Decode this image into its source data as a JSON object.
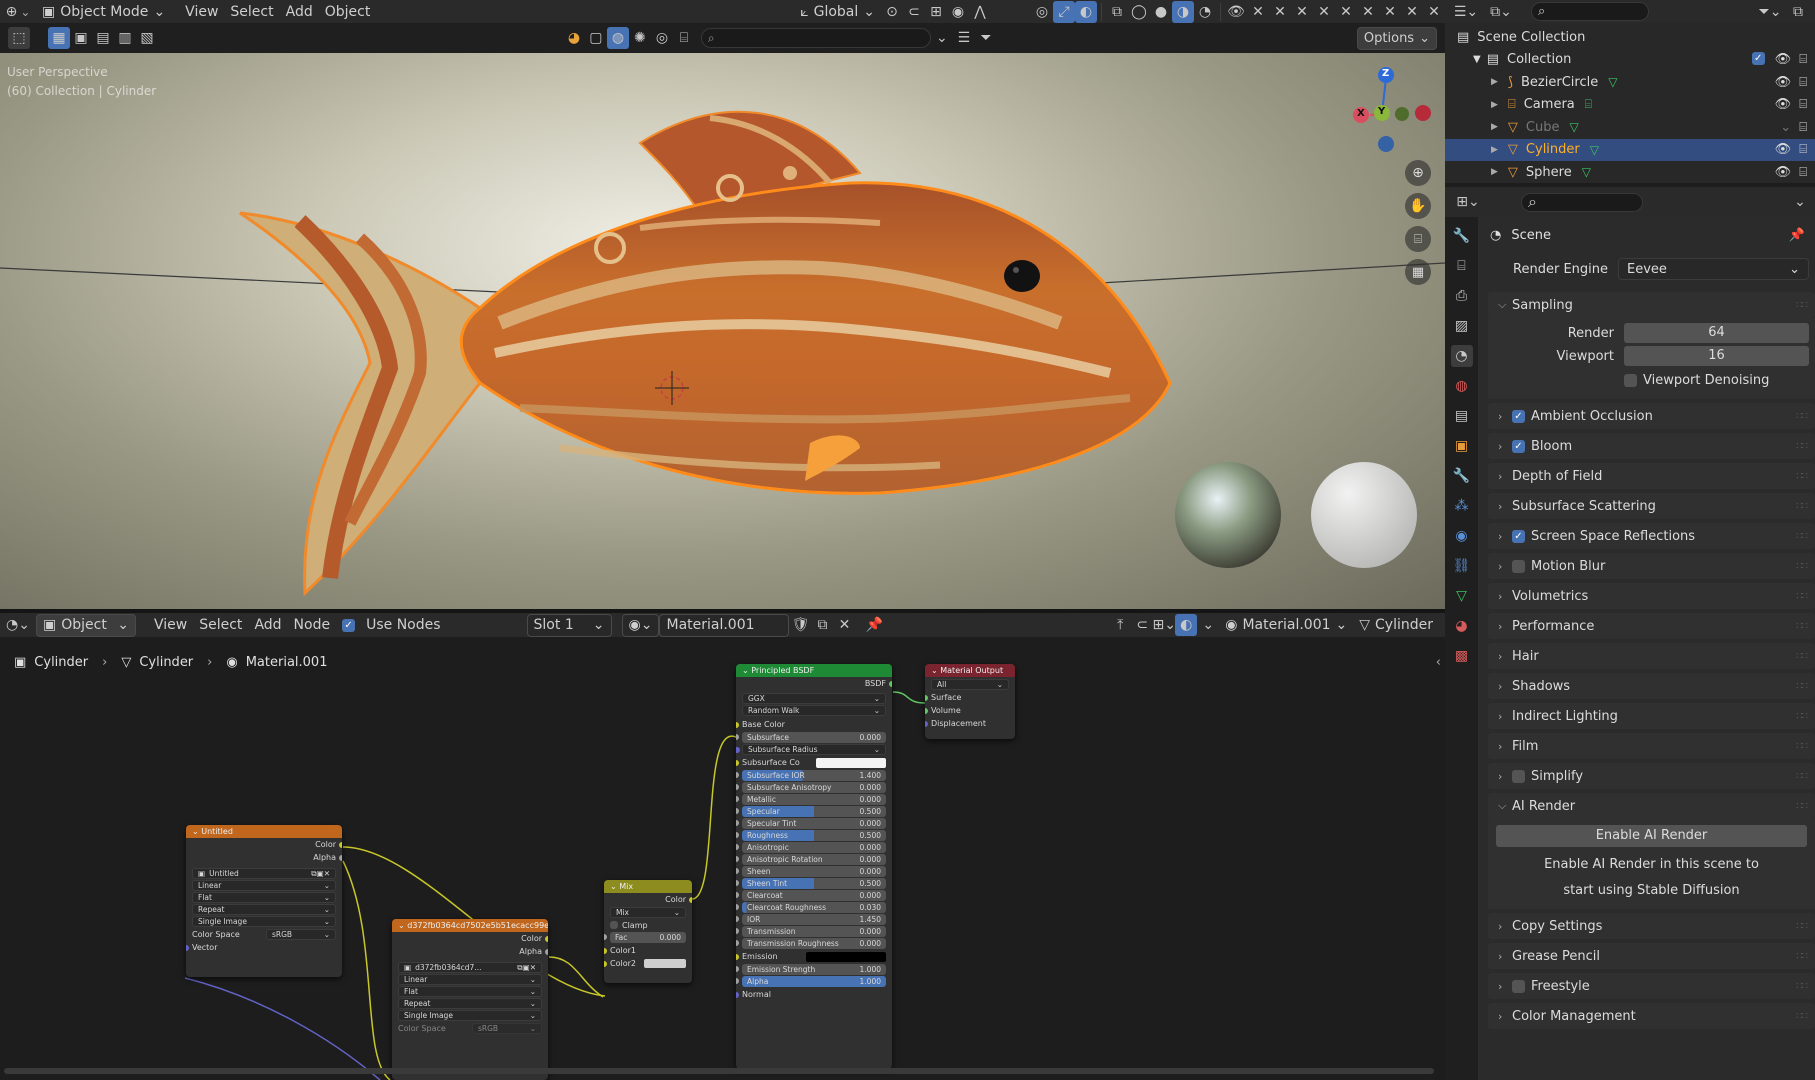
{
  "viewport_header": {
    "mode": "Object Mode",
    "menu": [
      "View",
      "Select",
      "Add",
      "Object"
    ],
    "transform_orientation": "Global",
    "options_label": "Options"
  },
  "viewport": {
    "info_line1": "User Perspective",
    "info_line2": "(60) Collection | Cylinder",
    "gizmo": {
      "z": "Z",
      "y": "Y",
      "x": "X"
    }
  },
  "outliner": {
    "root": "Scene Collection",
    "collection": "Collection",
    "items": [
      {
        "name": "BezierCircle",
        "icon": "curve-icon",
        "selected": false,
        "dim": false
      },
      {
        "name": "Camera",
        "icon": "camera-icon",
        "selected": false,
        "dim": false
      },
      {
        "name": "Cube",
        "icon": "mesh-icon",
        "selected": false,
        "dim": true
      },
      {
        "name": "Cylinder",
        "icon": "mesh-icon",
        "selected": true,
        "dim": false
      },
      {
        "name": "Sphere",
        "icon": "mesh-icon",
        "selected": false,
        "dim": false
      }
    ]
  },
  "properties": {
    "context": "Scene",
    "render_engine_label": "Render Engine",
    "render_engine_value": "Eevee",
    "sampling": {
      "title": "Sampling",
      "render_label": "Render",
      "render_value": "64",
      "viewport_label": "Viewport",
      "viewport_value": "16",
      "denoise_label": "Viewport Denoising"
    },
    "panels_a": [
      {
        "label": "Ambient Occlusion",
        "checkbox": true,
        "checked": true
      },
      {
        "label": "Bloom",
        "checkbox": true,
        "checked": true
      },
      {
        "label": "Depth of Field",
        "checkbox": false,
        "checked": false
      },
      {
        "label": "Subsurface Scattering",
        "checkbox": false,
        "checked": false
      },
      {
        "label": "Screen Space Reflections",
        "checkbox": true,
        "checked": true
      },
      {
        "label": "Motion Blur",
        "checkbox": true,
        "checked": false
      },
      {
        "label": "Volumetrics",
        "checkbox": false,
        "checked": false
      },
      {
        "label": "Performance",
        "checkbox": false,
        "checked": false
      },
      {
        "label": "Hair",
        "checkbox": false,
        "checked": false
      },
      {
        "label": "Shadows",
        "checkbox": false,
        "checked": false
      },
      {
        "label": "Indirect Lighting",
        "checkbox": false,
        "checked": false
      },
      {
        "label": "Film",
        "checkbox": false,
        "checked": false
      },
      {
        "label": "Simplify",
        "checkbox": true,
        "checked": false
      }
    ],
    "ai_render": {
      "title": "AI Render",
      "button": "Enable AI Render",
      "desc1": "Enable AI Render in this scene to",
      "desc2": "start using Stable Diffusion"
    },
    "panels_b": [
      {
        "label": "Copy Settings",
        "checkbox": false,
        "checked": false
      },
      {
        "label": "Grease Pencil",
        "checkbox": false,
        "checked": false
      },
      {
        "label": "Freestyle",
        "checkbox": true,
        "checked": false
      },
      {
        "label": "Color Management",
        "checkbox": false,
        "checked": false
      }
    ]
  },
  "node_header": {
    "type": "Object",
    "menu": [
      "View",
      "Select",
      "Add",
      "Node"
    ],
    "use_nodes": "Use Nodes",
    "slot": "Slot 1",
    "material": "Material.001",
    "material_right": "Material.001",
    "object_right": "Cylinder"
  },
  "breadcrumb": [
    "Cylinder",
    "Cylinder",
    "Material.001"
  ],
  "nodes": {
    "untitled": {
      "title": "Untitled",
      "out1": "Color",
      "out2": "Alpha",
      "image": "Untitled",
      "interp": "Linear",
      "proj": "Flat",
      "ext": "Repeat",
      "src": "Single Image",
      "cs_label": "Color Space",
      "cs_value": "sRGB",
      "vector": "Vector"
    },
    "tex2": {
      "title": "d372fb0364cd7502e5b51ecacc99ef8a",
      "out1": "Color",
      "out2": "Alpha",
      "image": "d372fb0364cd7...",
      "interp": "Linear",
      "proj": "Flat",
      "ext": "Repeat",
      "src": "Single Image",
      "cs_label": "Color Space",
      "cs_value": "sRGB"
    },
    "mix": {
      "title": "Mix",
      "out": "Color",
      "mode": "Mix",
      "clamp": "Clamp",
      "fac_label": "Fac",
      "fac_value": "0.000",
      "c1": "Color1",
      "c2": "Color2"
    },
    "bsdf": {
      "title": "Principled BSDF",
      "out": "BSDF",
      "dist": "GGX",
      "sss_method": "Random Walk",
      "base_color": "Base Color",
      "fields": [
        {
          "label": "Subsurface",
          "value": "0.000",
          "fill": 0
        },
        {
          "label": "Subsurface Radius",
          "value": "",
          "fill": 0,
          "dropdown": true
        },
        {
          "label": "Subsurface Co",
          "value": "",
          "fill": 0,
          "white": true
        },
        {
          "label": "Subsurface IOR",
          "value": "1.400",
          "fill": 0.42
        },
        {
          "label": "Subsurface Anisotropy",
          "value": "0.000",
          "fill": 0
        },
        {
          "label": "Metallic",
          "value": "0.000",
          "fill": 0
        },
        {
          "label": "Specular",
          "value": "0.500",
          "fill": 0.5
        },
        {
          "label": "Specular Tint",
          "value": "0.000",
          "fill": 0
        },
        {
          "label": "Roughness",
          "value": "0.500",
          "fill": 0.5
        },
        {
          "label": "Anisotropic",
          "value": "0.000",
          "fill": 0
        },
        {
          "label": "Anisotropic Rotation",
          "value": "0.000",
          "fill": 0
        },
        {
          "label": "Sheen",
          "value": "0.000",
          "fill": 0
        },
        {
          "label": "Sheen Tint",
          "value": "0.500",
          "fill": 0.5
        },
        {
          "label": "Clearcoat",
          "value": "0.000",
          "fill": 0
        },
        {
          "label": "Clearcoat Roughness",
          "value": "0.030",
          "fill": 0.03
        },
        {
          "label": "IOR",
          "value": "1.450",
          "fill": 0
        },
        {
          "label": "Transmission",
          "value": "0.000",
          "fill": 0
        },
        {
          "label": "Transmission Roughness",
          "value": "0.000",
          "fill": 0
        }
      ],
      "emission": "Emission",
      "emission_strength_label": "Emission Strength",
      "emission_strength": "1.000",
      "alpha_label": "Alpha",
      "alpha_value": "1.000",
      "normal": "Normal"
    },
    "output": {
      "title": "Material Output",
      "target": "All",
      "in1": "Surface",
      "in2": "Volume",
      "in3": "Displacement"
    }
  },
  "colors": {
    "accent": "#4772b3",
    "selection": "#ff8c1a",
    "texture_header": "#c0661d",
    "bsdf_header": "#1f8a36",
    "output_header": "#7a2430"
  }
}
